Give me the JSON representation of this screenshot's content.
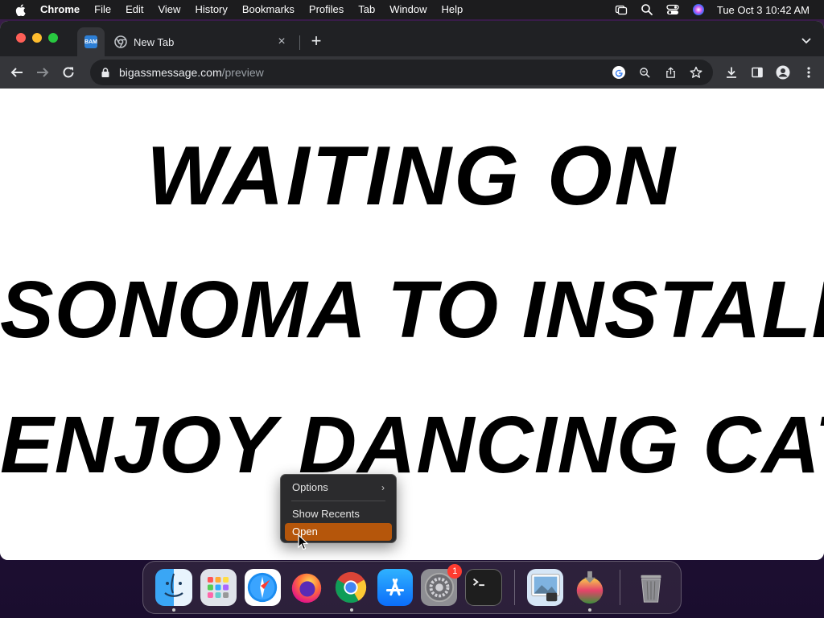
{
  "menubar": {
    "app_name": "Chrome",
    "items": [
      "File",
      "Edit",
      "View",
      "History",
      "Bookmarks",
      "Profiles",
      "Tab",
      "Window",
      "Help"
    ],
    "clock": "Tue Oct 3  10:42 AM"
  },
  "browser": {
    "pinned_tab_favicon": "BAM",
    "active_tab_title": "New Tab",
    "url_host": "bigassmessage.com",
    "url_path": "/preview"
  },
  "page": {
    "line1": "WAITING ON",
    "line2": "SONOMA TO INSTALL,",
    "line3": "ENJOY DANCING CAT"
  },
  "context_menu": {
    "options": "Options",
    "show_recents": "Show Recents",
    "open": "Open"
  },
  "dock": {
    "settings_badge": "1",
    "apps": [
      "finder-icon",
      "launchpad-icon",
      "safari-icon",
      "firefox-icon",
      "chrome-icon",
      "app-store-icon",
      "system-settings-icon",
      "terminal-icon",
      "preview-icon",
      "macos-installer-icon",
      "trash-icon"
    ]
  },
  "colors": {
    "menu_highlight": "#b5560b",
    "tab_strip": "#202124",
    "toolbar": "#35363a"
  }
}
